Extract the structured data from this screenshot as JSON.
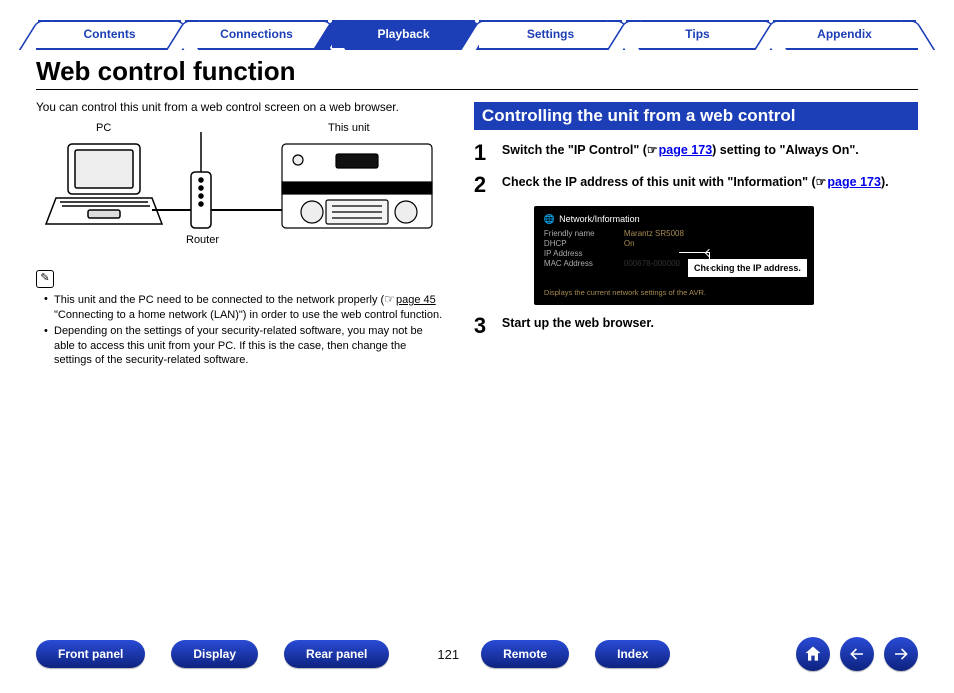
{
  "tabs": {
    "contents": "Contents",
    "connections": "Connections",
    "playback": "Playback",
    "settings": "Settings",
    "tips": "Tips",
    "appendix": "Appendix"
  },
  "page": {
    "title": "Web control function",
    "intro": "You can control this unit from a web control screen on a web browser.",
    "diagram": {
      "pc": "PC",
      "router": "Router",
      "unit": "This unit"
    },
    "note_icon": "✎",
    "notes": {
      "n1a": "This unit and the PC need to be connected to the network properly (",
      "n1b": "page 45",
      "n1c": " \"Connecting to a home network (LAN)\") in order to use the web control function.",
      "n2": "Depending on the settings of your security-related software, you may not be able to access this unit from your PC. If this is the case, then change the settings of the security-related software."
    },
    "section_title": "Controlling the unit from a web control",
    "steps": {
      "s1": {
        "n": "1",
        "a": "Switch the \"IP Control\" (",
        "link": "page 173",
        "b": ") setting to \"Always On\"."
      },
      "s2": {
        "n": "2",
        "a": "Check the IP address of this unit with \"Information\" (",
        "link": "page 173",
        "b": ")."
      },
      "s3": {
        "n": "3",
        "text": "Start up the web browser."
      }
    },
    "hand": "☞",
    "osd": {
      "title": "Network/Information",
      "rows": [
        {
          "k": "Friendly name",
          "v": "Marantz SR5008"
        },
        {
          "k": "DHCP",
          "v": "On"
        },
        {
          "k": "IP Address",
          "v": ""
        },
        {
          "k": "MAC Address",
          "v": "000678-000000"
        }
      ],
      "callout": "Checking the IP address.",
      "footer": "Displays the current network settings of the AVR."
    },
    "number": "121"
  },
  "footer": {
    "front_panel": "Front panel",
    "display": "Display",
    "rear_panel": "Rear panel",
    "remote": "Remote",
    "index": "Index"
  }
}
